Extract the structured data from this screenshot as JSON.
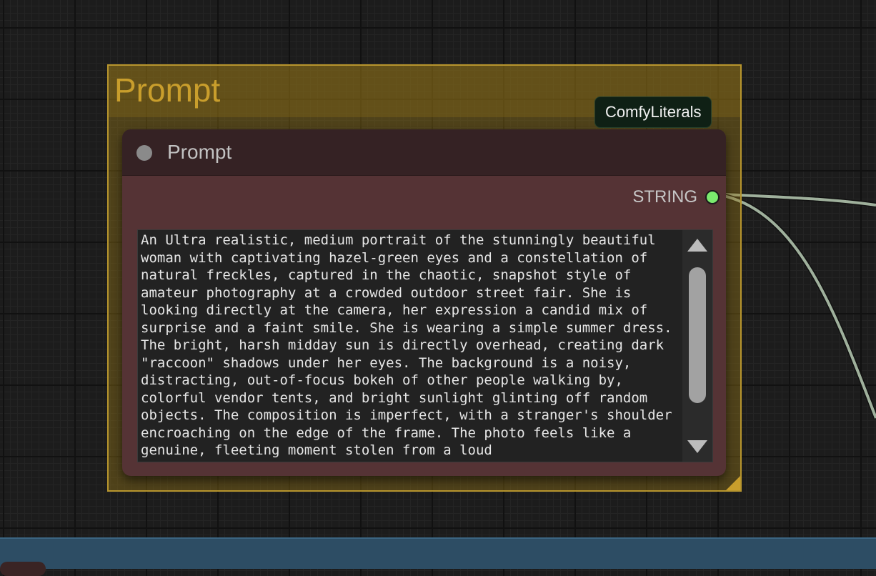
{
  "group": {
    "title": "Prompt",
    "color": "#b8962e"
  },
  "badge": {
    "label": "ComfyLiterals"
  },
  "node": {
    "title": "Prompt",
    "header_color": "#352224",
    "body_color": "#553335",
    "output": {
      "label": "STRING",
      "slot_color": "#7bea6e"
    },
    "text": "An Ultra realistic, medium portrait of the stunningly beautiful woman with captivating hazel-green eyes and a constellation of natural freckles, captured in the chaotic, snapshot style of amateur photography at a crowded outdoor street fair. She is looking directly at the camera, her expression a candid mix of surprise and a faint smile. She is wearing a simple summer dress. The bright, harsh midday sun is directly overhead, creating dark \"raccoon\" shadows under her eyes. The background is a noisy, distracting, out-of-focus bokeh of other people walking by, colorful vendor tents, and bright sunlight glinting off random objects. The composition is imperfect, with a stranger's shoulder encroaching on the edge of the frame. The photo feels like a genuine, fleeting moment stolen from a loud"
  },
  "wire": {
    "color": "#9fb09c"
  },
  "icons": {
    "collapse": "collapse-dot-icon",
    "scroll_up": "triangle-up-icon",
    "scroll_down": "triangle-down-icon"
  }
}
